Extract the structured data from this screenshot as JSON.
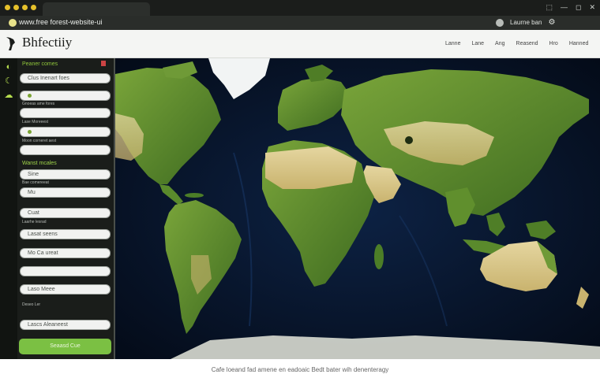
{
  "browser": {
    "url": "www.free forest-website-ui",
    "account_label": "Laurne ban",
    "window_controls": [
      "⬚",
      "—",
      "◻",
      "✕"
    ]
  },
  "app": {
    "brand": "Bhfectiiy",
    "nav": [
      "Lanne",
      "Lane",
      "Ang",
      "Reasend",
      "Hro",
      "Hanned"
    ]
  },
  "sidebar": {
    "title": "Peaner comes",
    "section_title": "Wanst mcales",
    "fields": [
      {
        "value": "Clus Inenart foes",
        "label": ""
      },
      {
        "value": "",
        "label": "Gnoeas ame fores"
      },
      {
        "value": "",
        "label": "Lase Moreeest"
      },
      {
        "value": "",
        "label": "Moon corneret aest"
      },
      {
        "value": "",
        "label": ""
      },
      {
        "value": "Sine",
        "label": "Bae comereeat"
      },
      {
        "value": "Mu",
        "label": ""
      },
      {
        "value": "Cuat",
        "label": "Laarhe lesrad"
      },
      {
        "value": "Lasat seens",
        "label": ""
      },
      {
        "value": "Mo Ca ureat",
        "label": ""
      },
      {
        "value": "",
        "label": ""
      },
      {
        "value": "Laso Meee",
        "label": "Deseo Ler"
      },
      {
        "value": "Lascs Aleaneest",
        "label": ""
      }
    ],
    "submit_label": "Seaasd Cue"
  },
  "footer": {
    "text": "Cafe loeand fad amene en eadoaic Bedt bater wih denenteragy"
  },
  "colors": {
    "accent": "#7bc043",
    "ocean": "#08142a",
    "land": "#5e8c2c",
    "desert": "#d9c98a"
  }
}
